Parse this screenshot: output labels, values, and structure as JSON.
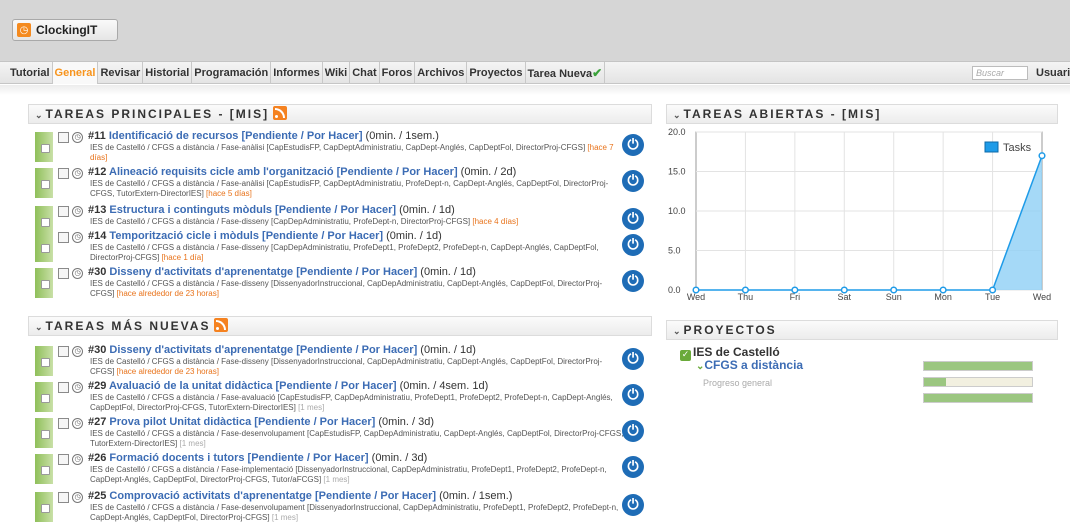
{
  "app": {
    "logo_text": "ClockingIT",
    "logo_icon": "clock-icon"
  },
  "nav": {
    "tabs": [
      "Tutorial",
      "General",
      "Revisar",
      "Historial",
      "Programación",
      "Informes",
      "Wiki",
      "Chat",
      "Foros",
      "Archivos",
      "Proyectos",
      "Tarea Nueva"
    ],
    "active": "General",
    "search_placeholder": "Buscar",
    "user_label": "Usuari"
  },
  "colors": {
    "accent": "#f7941d",
    "link": "#3c6cb4",
    "power_button": "#1e6cb6",
    "task_bar": "#8fbf5a"
  },
  "tareas_principales": {
    "title": "TAREAS PRINCIPALES - [MIS]",
    "tasks": [
      {
        "num": "#11",
        "title": "Identificació de recursos [Pendiente / Por Hacer]",
        "estimate": "(0min. / 1sem.)",
        "desc": "IES de Castelló / CFGS a distància / Fase-anàlisi [CapEstudisFP, CapDeptAdministratiu, CapDept-Anglés, CapDeptFol, DirectorProj-CFGS]",
        "ago": "[hace 7 días]"
      },
      {
        "num": "#12",
        "title": "Alineació requisits cicle amb l'organització [Pendiente / Por Hacer]",
        "estimate": "(0min. / 2d)",
        "desc": "IES de Castelló / CFGS a distància / Fase-anàlisi [CapEstudisFP, CapDeptAdministratiu, ProfeDept-n, CapDept-Anglés, CapDeptFol, DirectorProj-CFGS, TutorExtern-DirectorIES]",
        "ago": "[hace 5 días]"
      },
      {
        "num": "#13",
        "title": "Estructura i continguts mòduls [Pendiente / Por Hacer]",
        "estimate": "(0min. / 1d)",
        "desc": "IES de Castelló / CFGS a distància / Fase-disseny [CapDepAdministratiu, ProfeDept-n, DirectorProj-CFGS]",
        "ago": "[hace 4 días]"
      },
      {
        "num": "#14",
        "title": "Temporització cicle i mòduls [Pendiente / Por Hacer]",
        "estimate": "(0min. / 1d)",
        "desc": "IES de Castelló / CFGS a distància / Fase-disseny [CapDepAdministratiu, ProfeDept1, ProfeDept2, ProfeDept-n, CapDept-Anglés, CapDeptFol, DirectorProj-CFGS]",
        "ago": "[hace 1 día]"
      },
      {
        "num": "#30",
        "title": "Disseny d'activitats d'aprenentatge [Pendiente / Por Hacer]",
        "estimate": "(0min. / 1d)",
        "desc": "IES de Castelló / CFGS a distància / Fase-disseny [DissenyadorInstruccional, CapDepAdministratiu, CapDept-Anglés, CapDeptFol, DirectorProj-CFGS]",
        "ago": "[hace alrededor de 23 horas]"
      }
    ]
  },
  "tareas_nuevas": {
    "title": "TAREAS MÁS NUEVAS",
    "tasks": [
      {
        "num": "#30",
        "title": "Disseny d'activitats d'aprenentatge [Pendiente / Por Hacer]",
        "estimate": "(0min. / 1d)",
        "desc": "IES de Castelló / CFGS a distància / Fase-disseny [DissenyadorInstruccional, CapDepAdministratiu, CapDept-Anglés, CapDeptFol, DirectorProj-CFGS]",
        "ago": "[hace alrededor de 23 horas]"
      },
      {
        "num": "#29",
        "title": "Avaluació de la unitat didàctica [Pendiente / Por Hacer]",
        "estimate": "(0min. / 4sem. 1d)",
        "desc": "IES de Castelló / CFGS a distància / Fase-avaluació [CapEstudisFP, CapDepAdministratiu, ProfeDept1, ProfeDept2, ProfeDept-n, CapDept-Anglés, CapDeptFol, DirectorProj-CFGS, TutorExtern-DirectorIES]",
        "ago": "[1 mes]"
      },
      {
        "num": "#27",
        "title": "Prova pilot Unitat didàctica [Pendiente / Por Hacer]",
        "estimate": "(0min. / 3d)",
        "desc": "IES de Castelló / CFGS a distància / Fase-desenvolupament [CapEstudisFP, CapDepAdministratiu, CapDept-Anglés, CapDeptFol, DirectorProj-CFGS, TutorExtern-DirectorIES]",
        "ago": "[1 mes]"
      },
      {
        "num": "#26",
        "title": "Formació docents i tutors [Pendiente / Por Hacer]",
        "estimate": "(0min. / 3d)",
        "desc": "IES de Castelló / CFGS a distància / Fase-implementació [DissenyadorInstruccional, CapDepAdministratiu, ProfeDept1, ProfeDept2, ProfeDept-n, CapDept-Anglés, CapDeptFol, DirectorProj-CFGS, Tutor/aFCGS]",
        "ago": "[1 mes]"
      },
      {
        "num": "#25",
        "title": "Comprovació activitats d'aprenentatge [Pendiente / Por Hacer]",
        "estimate": "(0min. / 1sem.)",
        "desc": "IES de Castelló / CFGS a distància / Fase-desenvolupament [DissenyadorInstruccional, CapDepAdministratiu, ProfeDept1, ProfeDept2, ProfeDept-n, CapDept-Anglés, CapDeptFol, DirectorProj-CFGS]",
        "ago": "[1 mes]"
      }
    ]
  },
  "tareas_abiertas": {
    "title": "TAREAS ABIERTAS - [MIS]"
  },
  "chart_data": {
    "type": "area",
    "categories": [
      "Wed",
      "Thu",
      "Fri",
      "Sat",
      "Sun",
      "Mon",
      "Tue",
      "Wed"
    ],
    "series": [
      {
        "name": "Tasks",
        "values": [
          0,
          0,
          0,
          0,
          0,
          0,
          0,
          17
        ],
        "color": "#1e9be8"
      }
    ],
    "y_ticks": [
      "0.0",
      "5.0",
      "10.0",
      "15.0",
      "20.0"
    ],
    "ylim": [
      0,
      20
    ],
    "grid": true,
    "legend": "top-right",
    "title": "",
    "xlabel": "",
    "ylabel": ""
  },
  "proyectos": {
    "title": "PROYECTOS",
    "company": "IES de Castelló",
    "project": "CFGS a distància",
    "progress_label": "Progreso general",
    "bars": [
      1.0,
      0.2,
      1.0
    ]
  }
}
